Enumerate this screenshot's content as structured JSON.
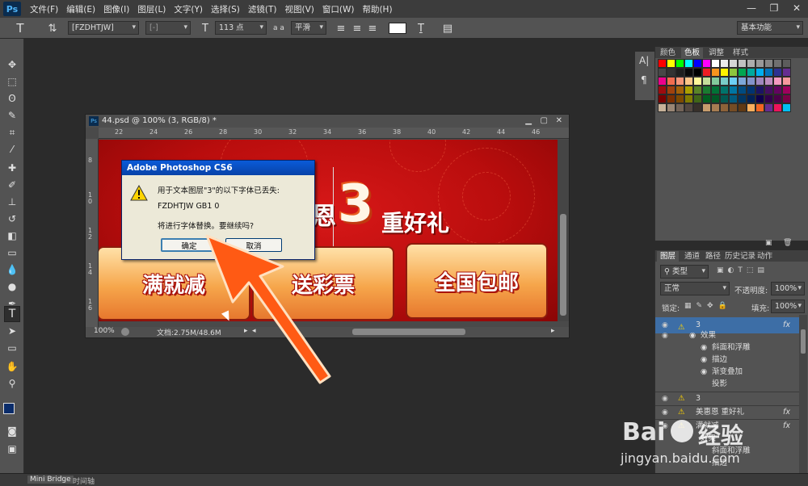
{
  "app": {
    "logo": "Ps"
  },
  "menubar": {
    "items": [
      "文件(F)",
      "编辑(E)",
      "图像(I)",
      "图层(L)",
      "文字(Y)",
      "选择(S)",
      "滤镜(T)",
      "视图(V)",
      "窗口(W)",
      "帮助(H)"
    ]
  },
  "options": {
    "font_family": "[FZDHTJW]",
    "font_style": "[-]",
    "font_size": "113 点",
    "aa_label": "a a",
    "antialias": "平滑",
    "workspace": "基本功能"
  },
  "document": {
    "title": "44.psd @ 100% (3, RGB/8) *",
    "ruler_top": [
      "22",
      "24",
      "26",
      "28",
      "30",
      "32",
      "34",
      "36",
      "38",
      "40",
      "42",
      "44",
      "46"
    ],
    "ruler_left": [
      "8",
      "1 0",
      "1 2",
      "1 4",
      "1 6"
    ],
    "canvas": {
      "title_suffix": "恩",
      "big_number": "3",
      "title_main": "重好礼",
      "button1": "满就减",
      "button2": "送彩票",
      "button3": "全国包邮"
    },
    "zoom": "100%",
    "doc_info": "文档:2.75M/48.6M"
  },
  "dialog": {
    "title": "Adobe Photoshop CS6",
    "line1": "用于文本图层\"3\"的以下字体已丢失:",
    "line2": "FZDHTJW GB1 0",
    "line3": "将进行字体替换。要继续吗?",
    "ok": "确定",
    "cancel": "取消"
  },
  "swatches_panel": {
    "tabs": [
      "颜色",
      "色板",
      "调整",
      "样式"
    ],
    "active_tab": "色板",
    "colors": [
      "#ff0000",
      "#ffff00",
      "#00ff00",
      "#00ffff",
      "#0000ff",
      "#ff00ff",
      "#ffffff",
      "#ebebeb",
      "#d6d6d6",
      "#c2c2c2",
      "#adadad",
      "#999999",
      "#858585",
      "#707070",
      "#5c5c5c",
      "#474747",
      "#333333",
      "#1f1f1f",
      "#0a0a0a",
      "#000000",
      "#ed1c24",
      "#f7941d",
      "#fff200",
      "#8dc63f",
      "#00a651",
      "#00a99d",
      "#00aeef",
      "#0072bc",
      "#2e3192",
      "#662d91",
      "#ec008c",
      "#f26c4f",
      "#f69679",
      "#fdc689",
      "#fff799",
      "#c4df9b",
      "#82ca9c",
      "#7accc8",
      "#6dcff6",
      "#7da7d9",
      "#8393ca",
      "#a187be",
      "#bd8cbf",
      "#f49ac1",
      "#f6989d",
      "#9e0b0f",
      "#a0410d",
      "#a36209",
      "#aba000",
      "#598527",
      "#197b30",
      "#007236",
      "#00746b",
      "#0076a3",
      "#004b80",
      "#003471",
      "#1b1464",
      "#440e62",
      "#630460",
      "#9e005d",
      "#790000",
      "#7b2e00",
      "#7d4900",
      "#827b00",
      "#406618",
      "#005e20",
      "#005826",
      "#005952",
      "#005b7f",
      "#003663",
      "#002157",
      "#0d004c",
      "#32004b",
      "#4b0049",
      "#7b0046",
      "#c7b299",
      "#998675",
      "#736357",
      "#534741",
      "#37302a",
      "#c69c6d",
      "#a67c52",
      "#8c6239",
      "#754c24",
      "#603913",
      "#fbaf5d",
      "#f26522",
      "#662d91",
      "#ed145b",
      "#00bff3"
    ]
  },
  "layers_panel": {
    "tabs": [
      "图层",
      "通道",
      "路径",
      "历史记录",
      "动作"
    ],
    "active_tab": "图层",
    "filter": "类型",
    "blend_mode": "正常",
    "opacity_label": "不透明度:",
    "opacity": "100%",
    "lock_label": "锁定:",
    "fill_label": "填充:",
    "fill": "100%",
    "rows": [
      {
        "name": "3",
        "fx": "fx"
      },
      {
        "name": "效果"
      },
      {
        "name": "斜面和浮雕"
      },
      {
        "name": "描边"
      },
      {
        "name": "渐变叠加"
      },
      {
        "name": "投影"
      },
      {
        "name": "3"
      },
      {
        "name": "美惠恩 重好礼",
        "fx": "fx"
      },
      {
        "name": "满就减",
        "fx": "fx"
      },
      {
        "name": "效果"
      },
      {
        "name": "斜面和浮雕"
      },
      {
        "name": "描边"
      }
    ]
  },
  "bottom_tabs": [
    "Mini Bridge",
    "时间轴"
  ],
  "watermark": {
    "brand": "Bai",
    "brand2": "经验",
    "url": "jingyan.baidu.com"
  },
  "colors": {
    "arrow": "#ff5a14",
    "dialog_title": "#0a5bd8",
    "fg": "#0a2c6a",
    "bg": "#ffffff"
  }
}
